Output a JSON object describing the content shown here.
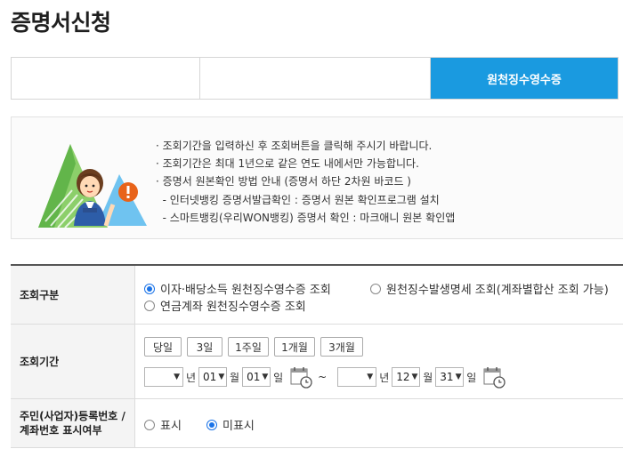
{
  "page": {
    "title": "증명서신청"
  },
  "tabs": [
    {
      "label": ""
    },
    {
      "label": ""
    },
    {
      "label": "원천징수영수증",
      "active": true
    }
  ],
  "notice": {
    "items": [
      "· 조회기간을 입력하신 후 조회버튼을 클릭해 주시기 바랍니다.",
      "· 조회기간은 최대 1년으로 같은 연도 내에서만 가능합니다.",
      "· 증명서 원본확인 방법 안내 (증명서 하단 2차원 바코드 )",
      "  - 인터넷뱅킹 증명서발급확인 : 증명서 원본 확인프로그램 설치",
      "  - 스마트뱅킹(우리WON뱅킹) 증명서 확인 : 마크애니 원본 확인앱"
    ]
  },
  "form": {
    "inquiry_type": {
      "label": "조회구분",
      "options": [
        {
          "label": "이자·배당소득 원천징수영수증 조회",
          "selected": true
        },
        {
          "label": "원천징수발생명세 조회(계좌별합산 조회 가능)",
          "selected": false
        },
        {
          "label": "연금계좌 원천징수영수증 조회",
          "selected": false
        }
      ]
    },
    "period": {
      "label": "조회기간",
      "quick_buttons": [
        "당일",
        "3일",
        "1주일",
        "1개월",
        "3개월"
      ],
      "from": {
        "year": "",
        "month": "01",
        "day": "01"
      },
      "to": {
        "year": "",
        "month": "12",
        "day": "31"
      },
      "unit_year": "년",
      "unit_month": "월",
      "unit_day": "일",
      "separator": "~"
    },
    "id_display": {
      "label_line1": "주민(사업자)등록번호 /",
      "label_line2": "계좌번호 표시여부",
      "options": [
        {
          "label": "표시",
          "selected": false
        },
        {
          "label": "미표시",
          "selected": true
        }
      ]
    }
  },
  "colors": {
    "accent": "#1a9ae0",
    "radio": "#1a73e8",
    "warning": "#e8631a"
  },
  "icons": [
    "calendar-icon",
    "warning-icon",
    "chevron-down-icon"
  ]
}
